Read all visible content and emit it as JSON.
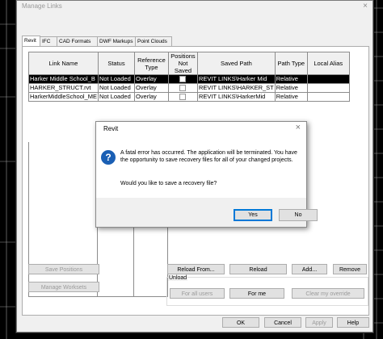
{
  "manage_links": {
    "title": "Manage Links",
    "close_glyph": "×",
    "tabs": [
      "Revit",
      "IFC",
      "CAD Formats",
      "DWF Markups",
      "Point Clouds"
    ],
    "columns": [
      "Link Name",
      "Status",
      "Reference Type",
      "Positions Not Saved",
      "Saved Path",
      "Path Type",
      "Local Alias"
    ],
    "rows": [
      {
        "link_name": "Harker Middle School_B",
        "status": "Not Loaded",
        "reference_type": "Overlay",
        "positions_not_saved": false,
        "saved_path": "REVIT LINKS\\Harker Mid",
        "path_type": "Relative",
        "local_alias": ""
      },
      {
        "link_name": "HARKER_STRUCT.rvt",
        "status": "Not Loaded",
        "reference_type": "Overlay",
        "positions_not_saved": false,
        "saved_path": "REVIT LINKS\\HARKER_ST",
        "path_type": "Relative",
        "local_alias": ""
      },
      {
        "link_name": "HarkerMiddleSchool_ME",
        "status": "Not Loaded",
        "reference_type": "Overlay",
        "positions_not_saved": false,
        "saved_path": "REVIT LINKS\\HarkerMid",
        "path_type": "Relative",
        "local_alias": ""
      }
    ],
    "buttons": {
      "save_positions": "Save Positions",
      "manage_worksets": "Manage Worksets",
      "reload_from": "Reload From...",
      "reload": "Reload",
      "add": "Add...",
      "remove": "Remove"
    },
    "unload": {
      "label": "Unload",
      "for_all_users": "For all users",
      "for_me": "For me",
      "clear_override": "Clear my override"
    },
    "footer": {
      "ok": "OK",
      "cancel": "Cancel",
      "apply": "Apply",
      "help": "Help"
    }
  },
  "error_dialog": {
    "title": "Revit",
    "close_glyph": "×",
    "icon": "question-icon",
    "message": "A fatal error has occurred.  The application will be terminated.  You have the opportunity to save recovery files for all of your changed projects.",
    "question": "Would you like to save a recovery file?",
    "yes": "Yes",
    "no": "No"
  }
}
